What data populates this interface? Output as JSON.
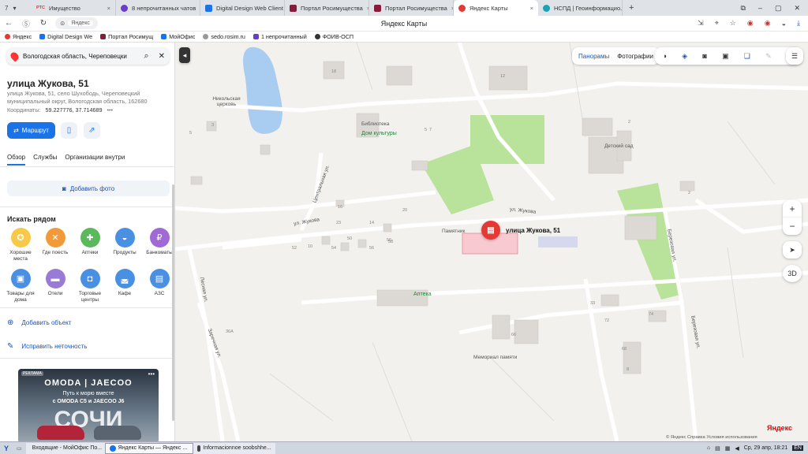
{
  "browser": {
    "profile_letter": "7",
    "tabs": [
      {
        "label": "Имущество",
        "color": "#d33"
      },
      {
        "label": "8 непрочитанных чатов",
        "color": "#6a3cc9"
      },
      {
        "label": "Digital Design Web Client",
        "color": "#1a73e8"
      },
      {
        "label": "Портал Росимущества",
        "color": "#8a1a3a"
      },
      {
        "label": "Портал Росимущества",
        "color": "#8a1a3a"
      },
      {
        "label": "Яндекс Карты",
        "color": "#e53935",
        "active": true
      },
      {
        "label": "НСПД | Геоинформацио...",
        "color": "#1aa3b8"
      }
    ],
    "first_tab_badge": "РТС",
    "url_text": "Яндекс",
    "page_title": "Яндекс Карты",
    "bookmarks": [
      {
        "label": "Яндекс",
        "color": "#e53935"
      },
      {
        "label": "Digital Design We",
        "color": "#1a73e8"
      },
      {
        "label": "Портал Росимущ",
        "color": "#8a1a3a"
      },
      {
        "label": "МойОфис",
        "color": "#1a73e8"
      },
      {
        "label": "sedo.rosim.ru",
        "color": "#555"
      },
      {
        "label": "1 непрочитанный",
        "color": "#6a3cc9"
      },
      {
        "label": "ФОИВ-ОСП",
        "color": "#333"
      }
    ]
  },
  "sidebar": {
    "search_value": "Вологодская область, Череповецки",
    "title": "улица Жукова, 51",
    "subtitle": "улица Жукова, 51, село Шухободь, Череповецкий муниципальный округ, Вологодская область, 162680",
    "coords_label": "Координаты:",
    "coords_value": "59.227776, 37.714689",
    "route_label": "Маршрут",
    "tabs": [
      "Обзор",
      "Службы",
      "Организации внутри"
    ],
    "add_photo": "Добавить фото",
    "nearby_heading": "Искать рядом",
    "categories": [
      {
        "label": "Хорошие места",
        "color": "#f7c948",
        "icon": "medal-icon",
        "glyph": "✪"
      },
      {
        "label": "Где поесть",
        "color": "#f29a3a",
        "icon": "fork-knife-icon",
        "glyph": "✕"
      },
      {
        "label": "Аптеки",
        "color": "#5cb85c",
        "icon": "pharmacy-cross-icon",
        "glyph": "✚"
      },
      {
        "label": "Продукты",
        "color": "#4a90e2",
        "icon": "basket-icon",
        "glyph": "◒"
      },
      {
        "label": "Банкоматы",
        "color": "#a06ad6",
        "icon": "ruble-icon",
        "glyph": "₽"
      },
      {
        "label": "Товары для дома",
        "color": "#4a90e2",
        "icon": "bag-icon",
        "glyph": "▣"
      },
      {
        "label": "Отели",
        "color": "#9b7ad6",
        "icon": "bed-icon",
        "glyph": "▬"
      },
      {
        "label": "Торговые центры",
        "color": "#4a90e2",
        "icon": "shopping-bag-icon",
        "glyph": "◘"
      },
      {
        "label": "Кафе",
        "color": "#4a90e2",
        "icon": "cup-icon",
        "glyph": "◛"
      },
      {
        "label": "АЗС",
        "color": "#4a90e2",
        "icon": "fuel-icon",
        "glyph": "▤"
      }
    ],
    "add_object": "Добавить объект",
    "fix_error": "Исправить неточность",
    "ad": {
      "tag": "РЕКЛАМА",
      "brand": "OMODA | JAECOO",
      "line1": "Путь к морю вместе",
      "line2": "с OMODA C5 и JAECOO J6",
      "big": "СОЧИ"
    }
  },
  "map": {
    "panoramas": "Панорамы",
    "photos": "Фотографии",
    "marker_label": "улица Жукова, 51",
    "marker_glyph": "▤",
    "btn_3d": "3D",
    "zoom_in": "+",
    "zoom_out": "−",
    "labels": [
      {
        "t": "Никольская церковь",
        "id": "church"
      },
      {
        "t": "Библиотека",
        "id": "library"
      },
      {
        "t": "Детский сад",
        "id": "kindergarten"
      },
      {
        "t": "Памятник",
        "id": "monument"
      },
      {
        "t": "Мемориал памяти",
        "id": "memorial"
      },
      {
        "t": "ул. Жукова",
        "id": "street1"
      },
      {
        "t": "ул. Жукова",
        "id": "street2"
      },
      {
        "t": "Центральная ул.",
        "id": "street3"
      },
      {
        "t": "Лесная ул.",
        "id": "street4"
      },
      {
        "t": "Заречная ул.",
        "id": "street5"
      },
      {
        "t": "Березовая ул.",
        "id": "street6"
      },
      {
        "t": "Березовая ул.",
        "id": "street7"
      }
    ],
    "green_labels": [
      "Дом культуры",
      "Аптека"
    ],
    "house_numbers": [
      "18",
      "12",
      "3",
      "5",
      "2",
      "7",
      "16",
      "20",
      "23",
      "14",
      "50",
      "54",
      "56",
      "58",
      "10",
      "52",
      "56",
      "5",
      "36A",
      "33",
      "72",
      "74",
      "66",
      "68",
      "2",
      "8"
    ],
    "copyright": "© Яндекс  Справка  Условия использования",
    "logo": "Яндекс"
  },
  "taskbar": {
    "items": [
      {
        "label": "Входящие - МойОфис По...",
        "color": "#e8b93a"
      },
      {
        "label": "Яндекс Карты — Яндекс ...",
        "color": "#1a73e8"
      },
      {
        "label": "Informacionnoe soobshhe...",
        "color": "#333"
      }
    ],
    "clock": "Ср, 29 апр, 18:21",
    "lang": "EN"
  }
}
